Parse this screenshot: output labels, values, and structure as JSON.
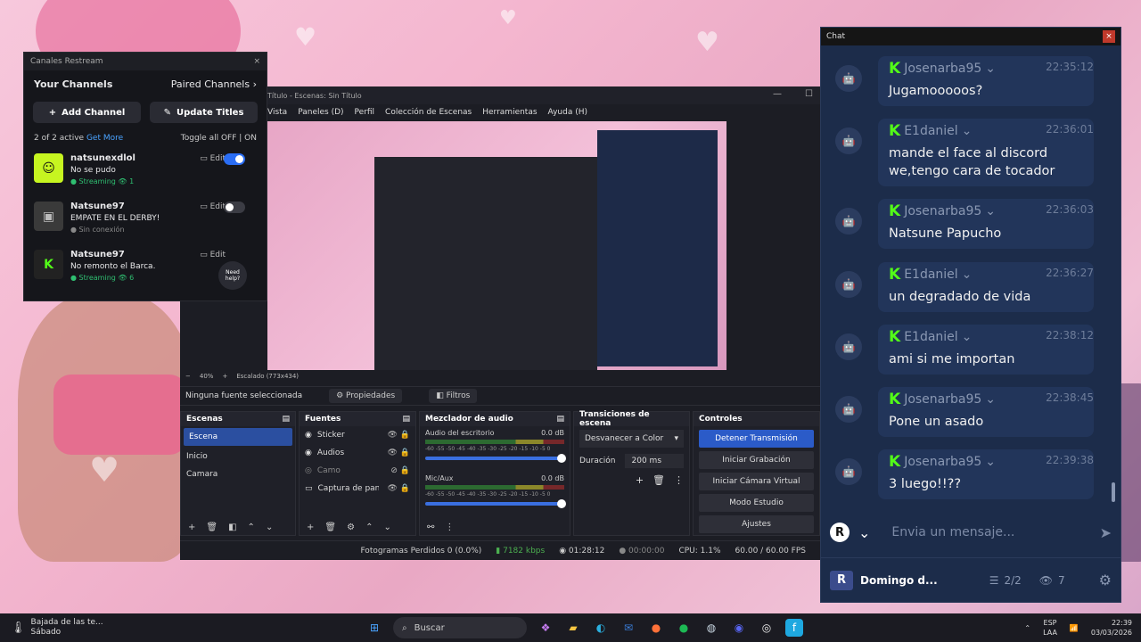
{
  "restream": {
    "window_title": "Canales Restream",
    "your_channels": "Your Channels",
    "paired_channels": "Paired Channels",
    "add_channel": "Add Channel",
    "update_titles": "Update Titles",
    "active_count": "2 of 2 active",
    "get_more": "Get More",
    "toggle_all": "Toggle all",
    "off": "OFF",
    "on": "ON",
    "edit": "Edit",
    "need_help": "Need help?",
    "channels": [
      {
        "name": "natsunexdlol",
        "title": "No se pudo",
        "status": "Streaming",
        "viewers": "1",
        "enabled": true
      },
      {
        "name": "Natsune97",
        "title": "EMPATE EN EL DERBY!",
        "status": "Sin conexión",
        "viewers": "",
        "enabled": false
      },
      {
        "name": "Natsune97",
        "title": "No remonto el Barca.",
        "status": "Streaming",
        "viewers": "6",
        "enabled": true
      }
    ]
  },
  "obs": {
    "window_title": "Título - Escenas: Sin Título",
    "menu": [
      "Vista",
      "Paneles (D)",
      "Perfil",
      "Colección de Escenas",
      "Herramientas",
      "Ayuda (H)"
    ],
    "zoom": "40%",
    "scaling": "Escalado (773x434)",
    "no_source": "Ninguna fuente seleccionada",
    "properties": "Propiedades",
    "filters": "Filtros",
    "scenes_title": "Escenas",
    "scenes": [
      "Escena",
      "Inicio",
      "Camara"
    ],
    "sources_title": "Fuentes",
    "sources": [
      "Sticker",
      "Audios",
      "Camo",
      "Captura de pantalla"
    ],
    "mixer_title": "Mezclador de audio",
    "mixer": [
      {
        "name": "Audio del escritorio",
        "db": "0.0 dB"
      },
      {
        "name": "Mic/Aux",
        "db": "0.0 dB"
      }
    ],
    "mixer_scale": "-60 -55 -50 -45 -40 -35 -30 -25 -20 -15 -10 -5 0",
    "transitions_title": "Transiciones de escena",
    "transition": "Desvanecer a Color",
    "duration_label": "Duración",
    "duration": "200 ms",
    "controls_title": "Controles",
    "controls": [
      "Detener Transmisión",
      "Iniciar Grabación",
      "Iniciar Cámara Virtual",
      "Modo Estudio",
      "Ajustes"
    ],
    "status": {
      "dropped": "Fotogramas Perdidos 0 (0.0%)",
      "kbps": "7182 kbps",
      "live_time": "01:28:12",
      "rec_time": "00:00:00",
      "cpu": "CPU: 1.1%",
      "fps": "60.00 / 60.00 FPS"
    }
  },
  "chat": {
    "window_title": "Chat",
    "messages": [
      {
        "user": "Josenarba95",
        "time": "22:35:12",
        "text": "Jugamooooos?"
      },
      {
        "user": "E1daniel",
        "time": "22:36:01",
        "text": "mande el face al discord we,tengo cara de tocador"
      },
      {
        "user": "Josenarba95",
        "time": "22:36:03",
        "text": "Natsune Papucho"
      },
      {
        "user": "E1daniel",
        "time": "22:36:27",
        "text": "un degradado de vida"
      },
      {
        "user": "E1daniel",
        "time": "22:38:12",
        "text": "ami si me importan"
      },
      {
        "user": "Josenarba95",
        "time": "22:38:45",
        "text": "Pone un asado"
      },
      {
        "user": "Josenarba95",
        "time": "22:39:38",
        "text": "3 luego!!??"
      }
    ],
    "placeholder": "Envia un mensaje...",
    "channel": "Domingo d...",
    "channels_count": "2/2",
    "viewers": "7"
  },
  "taskbar": {
    "weather_line1": "Bajada de las te...",
    "weather_line2": "Sábado",
    "search": "Buscar",
    "lang": "ESP",
    "lang2": "LAA",
    "time": "22:39",
    "date": "03/03/2026"
  }
}
